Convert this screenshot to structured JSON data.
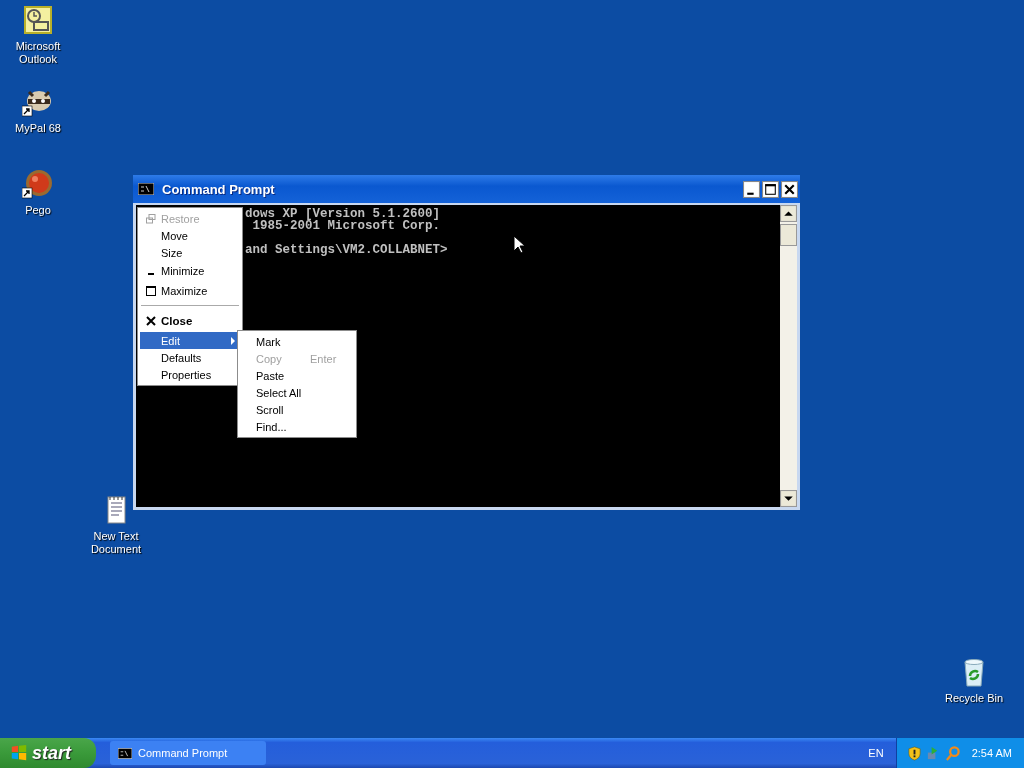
{
  "desktop_icons": [
    {
      "label": "Microsoft Outlook",
      "kind": "outlook",
      "shortcut": false
    },
    {
      "label": "MyPal 68",
      "kind": "raccoon",
      "shortcut": true
    },
    {
      "label": "Pego",
      "kind": "orb",
      "shortcut": true
    },
    {
      "label": "New Text Document",
      "kind": "notepad",
      "shortcut": false
    },
    {
      "label": "Recycle Bin",
      "kind": "recycle",
      "shortcut": false
    }
  ],
  "window": {
    "title": "Command Prompt",
    "console_lines": [
      "dows XP [Version 5.1.2600]",
      " 1985-2001 Microsoft Corp.",
      "and Settings\\VM2.COLLABNET>"
    ]
  },
  "system_menu": [
    {
      "kind": "restore",
      "label": "Restore",
      "disabled": true,
      "selected": false
    },
    {
      "kind": "plain",
      "label": "Move",
      "disabled": false,
      "selected": false
    },
    {
      "kind": "plain",
      "label": "Size",
      "disabled": false,
      "selected": false
    },
    {
      "kind": "minimize",
      "label": "Minimize",
      "disabled": false,
      "selected": false
    },
    {
      "kind": "maximize",
      "label": "Maximize",
      "disabled": false,
      "selected": false
    },
    {
      "kind": "separator"
    },
    {
      "kind": "close",
      "label": "Close",
      "disabled": false,
      "selected": false
    },
    {
      "kind": "submenu",
      "label": "Edit",
      "disabled": false,
      "selected": true
    },
    {
      "kind": "plain",
      "label": "Defaults",
      "disabled": false,
      "selected": false
    },
    {
      "kind": "plain",
      "label": "Properties",
      "disabled": false,
      "selected": false
    }
  ],
  "edit_submenu": [
    {
      "label": "Mark",
      "disabled": false
    },
    {
      "label": "Copy",
      "disabled": true,
      "shortcut": "Enter"
    },
    {
      "label": "Paste",
      "disabled": false
    },
    {
      "label": "Select All",
      "disabled": false
    },
    {
      "label": "Scroll",
      "disabled": false
    },
    {
      "label": "Find...",
      "disabled": false
    }
  ],
  "taskbar": {
    "start": "start",
    "tasks": [
      {
        "label": "Command Prompt"
      }
    ],
    "language": "EN",
    "clock": "2:54 AM"
  }
}
